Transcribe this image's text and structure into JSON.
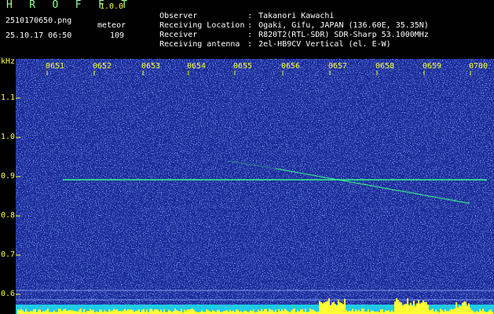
{
  "app": {
    "brand": "H R O F F T",
    "version": "1.0.0"
  },
  "file": {
    "name": "2510170650.png",
    "timestamp": "25.10.17 06:50"
  },
  "category": {
    "label": "meteor",
    "count": "109"
  },
  "station": {
    "rows": [
      {
        "label": "Observer",
        "value": "Takanori Kawachi"
      },
      {
        "label": "Receiving Location",
        "value": "Ogaki, Gifu, JAPAN (136.60E, 35.35N)"
      },
      {
        "label": "Receiver",
        "value": "R820T2(RTL-SDR) SDR-Sharp 53.1000MHz"
      },
      {
        "label": "Receiving antenna",
        "value": "2el-HB9CV Vertical (el. E-W)"
      }
    ]
  },
  "axis": {
    "unit": "kHz",
    "y_ticks": [
      "1.1",
      "1.0",
      "0.9",
      "0.8",
      "0.7",
      "0.6"
    ],
    "x_ticks": [
      "0651",
      "0652",
      "0653",
      "0654",
      "0655",
      "0656",
      "0657",
      "0658",
      "0659",
      "0700"
    ]
  },
  "colors": {
    "label_yellow": "#ffff33",
    "brand_green": "#99ff99",
    "text_white": "#ffffff",
    "background_blue": "#1a2a9a",
    "signal_green": "#33ff88"
  }
}
